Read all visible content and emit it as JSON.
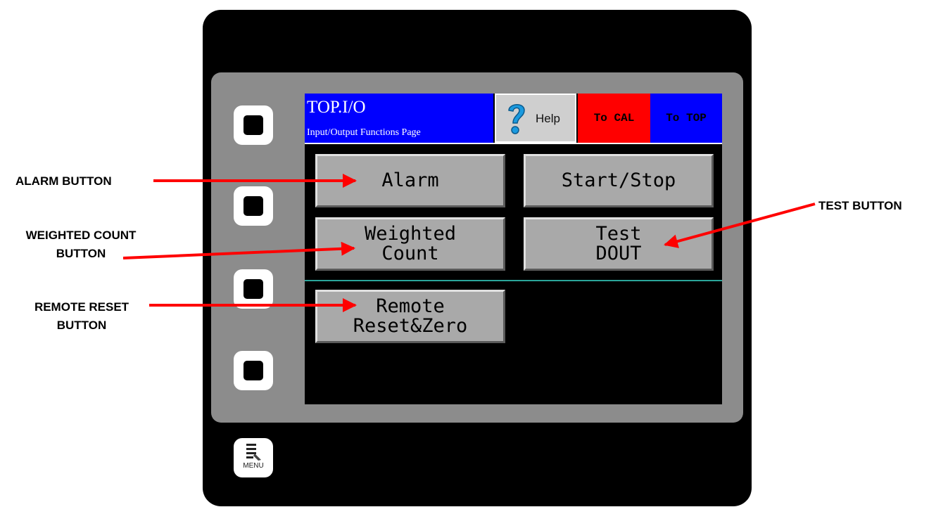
{
  "screen": {
    "title": "TOP.I/O",
    "subtitle": "Input/Output Functions Page",
    "help_label": "Help",
    "to_cal_label": "To CAL",
    "to_top_label": "To TOP",
    "buttons": {
      "alarm": "Alarm",
      "start_stop": "Start/Stop",
      "weighted_count": "Weighted\nCount",
      "test_dout": "Test\nDOUT",
      "remote_reset": "Remote\nReset&Zero"
    }
  },
  "device": {
    "menu_label": "MENU"
  },
  "callouts": {
    "alarm": "ALARM BUTTON",
    "weighted_count_line1": "WEIGHTED COUNT",
    "weighted_count_line2": "BUTTON",
    "remote_reset_line1": "REMOTE RESET",
    "remote_reset_line2": "BUTTON",
    "test": "TEST BUTTON"
  },
  "colors": {
    "arrow": "#ff0000",
    "title_bar": "#0000ff",
    "to_cal": "#ff0000",
    "to_top": "#0000ff",
    "button_face": "#a9a9a9",
    "divider": "#2aa59a"
  }
}
